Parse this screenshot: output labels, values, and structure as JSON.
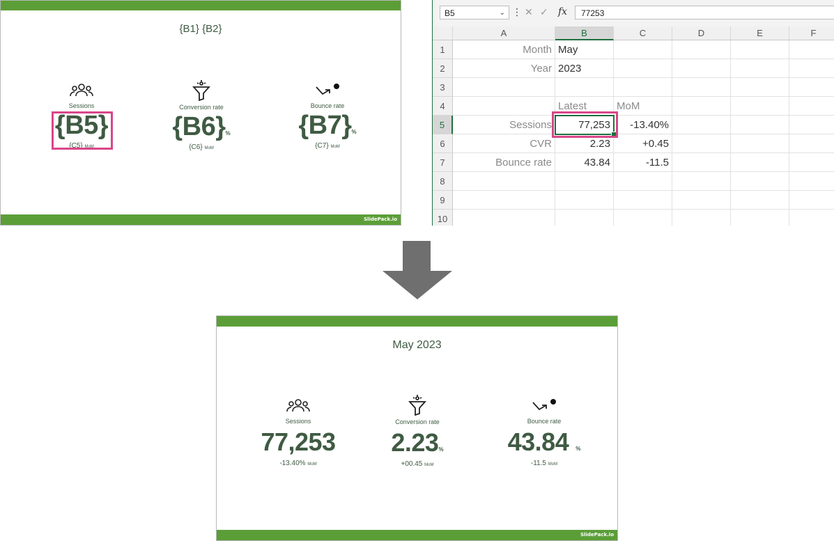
{
  "template_slide": {
    "title": "{B1} {B2}",
    "brand": "SlidePack.io",
    "kpis": [
      {
        "icon": "people-icon",
        "label": "Sessions",
        "value": "{B5}",
        "unit": "",
        "sub": "{C5}",
        "sub_suffix": "MoM"
      },
      {
        "icon": "funnel-icon",
        "label": "Conversion rate",
        "value": "{B6}",
        "unit": "%",
        "sub": "{C6}",
        "sub_suffix": "MoM"
      },
      {
        "icon": "bounce-arrow-icon",
        "label": "Bounce rate",
        "value": "{B7}",
        "unit": "%",
        "sub": "{C7}",
        "sub_suffix": "MoM"
      }
    ]
  },
  "excel": {
    "name_box": "B5",
    "formula_value": "77253",
    "columns": [
      "A",
      "B",
      "C",
      "D",
      "E",
      "F"
    ],
    "rows": [
      "1",
      "2",
      "3",
      "4",
      "5",
      "6",
      "7",
      "8",
      "9",
      "10"
    ],
    "cells": {
      "A1": "Month",
      "B1": "May",
      "A2": "Year",
      "B2": "2023",
      "B4": "Latest",
      "C4": "MoM",
      "A5": "Sessions",
      "B5": "77,253",
      "C5": "-13.40%",
      "A6": "CVR",
      "B6": "2.23",
      "C6": "+0.45",
      "A7": "Bounce rate",
      "B7": "43.84",
      "C7": "-11.5"
    },
    "accent_color": "#1e6f3e"
  },
  "result_slide": {
    "title": "May 2023",
    "brand": "SlidePack.io",
    "kpis": [
      {
        "icon": "people-icon",
        "label": "Sessions",
        "value": "77,253",
        "unit": "",
        "sub": "-13.40%",
        "sub_suffix": "MoM"
      },
      {
        "icon": "funnel-icon",
        "label": "Conversion rate",
        "value": "2.23",
        "unit": "%",
        "sub": "+00.45",
        "sub_suffix": "MoM"
      },
      {
        "icon": "bounce-arrow-icon",
        "label": "Bounce rate",
        "value": "43.84",
        "unit": "%",
        "sub": "-11.5",
        "sub_suffix": "MoM"
      }
    ]
  },
  "colors": {
    "slide_green": "#5b9e38",
    "text_green": "#3f5b43",
    "highlight_pink": "#d9468a",
    "arrow_grey": "#6f6f6f"
  }
}
